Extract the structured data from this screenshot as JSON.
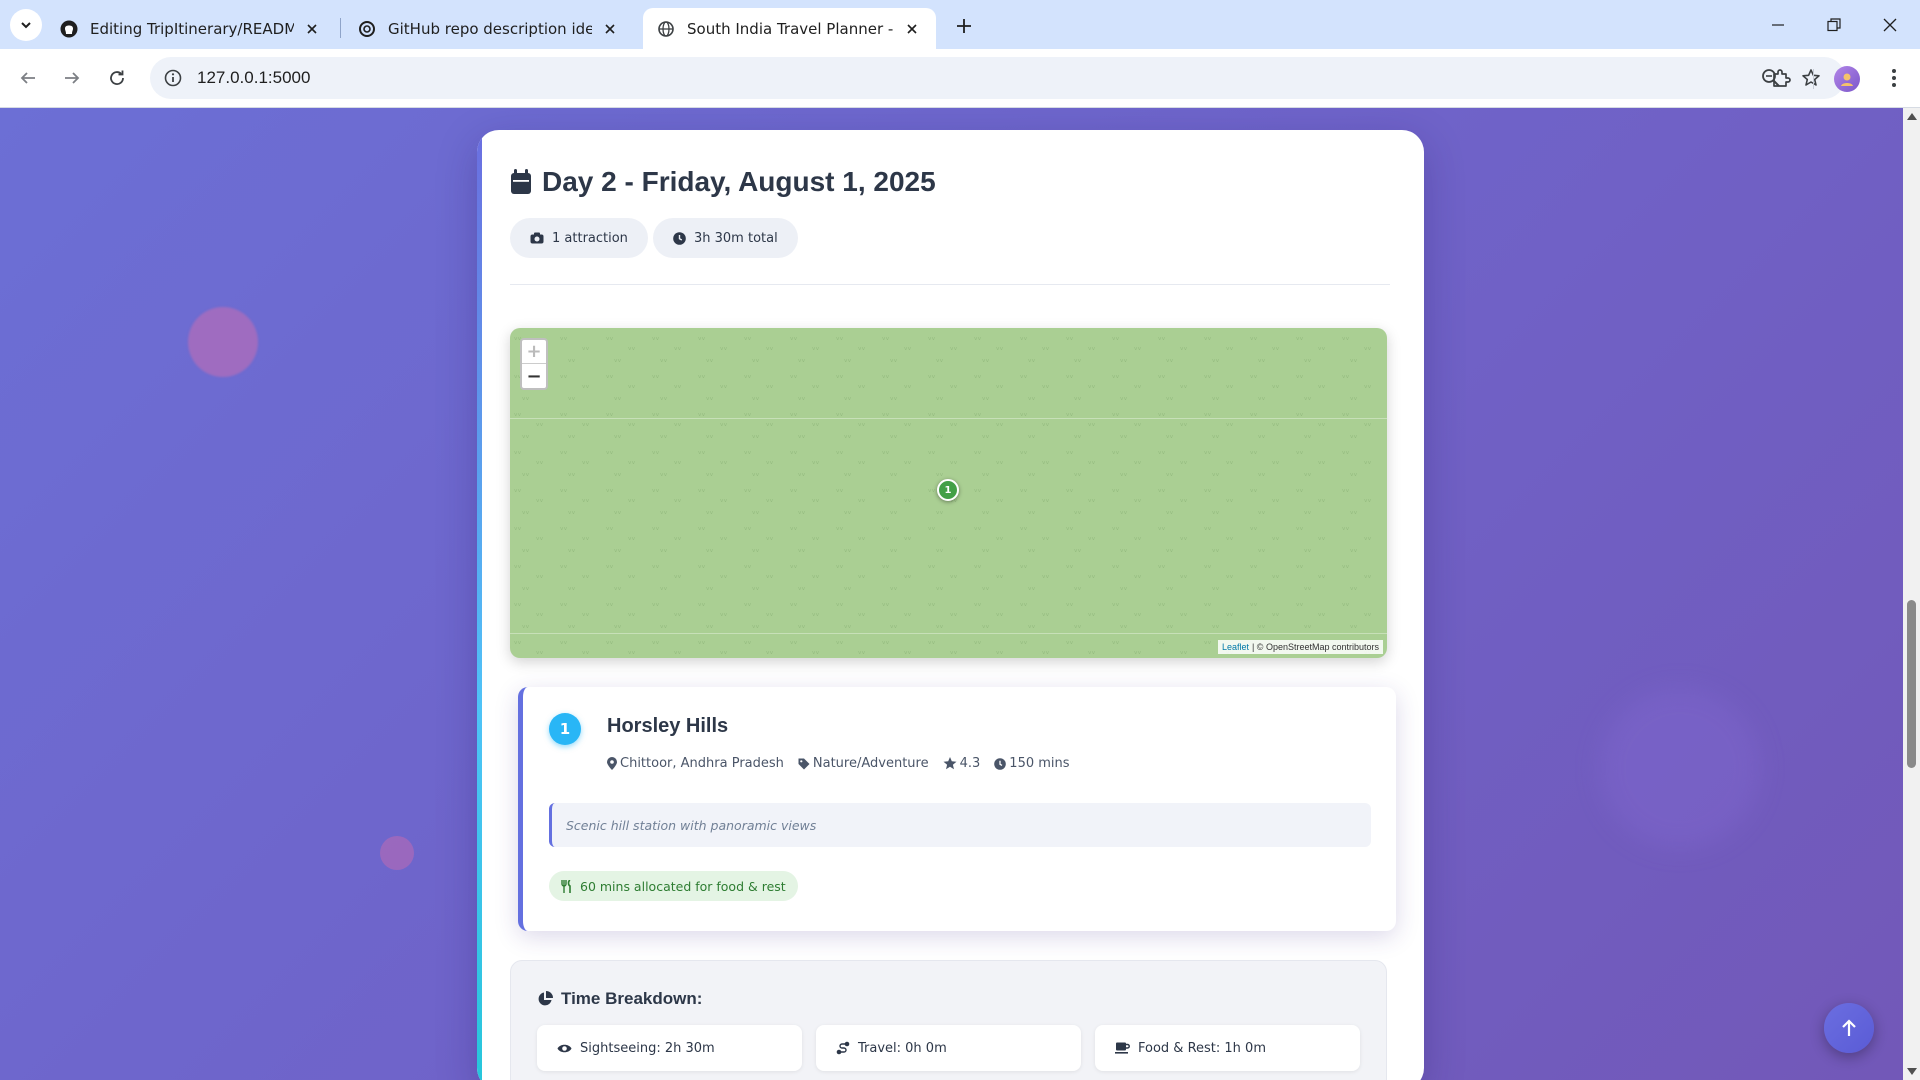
{
  "browser": {
    "tabs": [
      {
        "title": "Editing TripItinerary/README.m",
        "favicon": "github-icon"
      },
      {
        "title": "GitHub repo description ideas",
        "favicon": "openai-icon"
      },
      {
        "title": "South India Travel Planner - You",
        "favicon": "globe-icon",
        "active": true
      }
    ],
    "url": "127.0.0.1:5000"
  },
  "day": {
    "title": "Day 2 - Friday, August 1, 2025",
    "attractions_badge": "1 attraction",
    "time_badge": "3h 30m total"
  },
  "map": {
    "zoom_in": "+",
    "zoom_out": "−",
    "marker_label": "1",
    "attribution_leaflet": "Leaflet",
    "attribution_osm": "| © OpenStreetMap contributors"
  },
  "attraction": {
    "number": "1",
    "name": "Horsley Hills",
    "location": "Chittoor, Andhra Pradesh",
    "category": "Nature/Adventure",
    "rating": "4.3",
    "duration": "150 mins",
    "description": "Scenic hill station with panoramic views",
    "food_note": "60 mins allocated for food & rest"
  },
  "breakdown": {
    "title": "Time Breakdown:",
    "sightseeing": "Sightseeing: 2h 30m",
    "travel": "Travel: 0h 0m",
    "food": "Food & Rest: 1h 0m"
  },
  "colors": {
    "accent": "#6470e0",
    "marker": "#43a047",
    "badge_blue": "#29b6f6",
    "food_green": "#2e7d32"
  }
}
